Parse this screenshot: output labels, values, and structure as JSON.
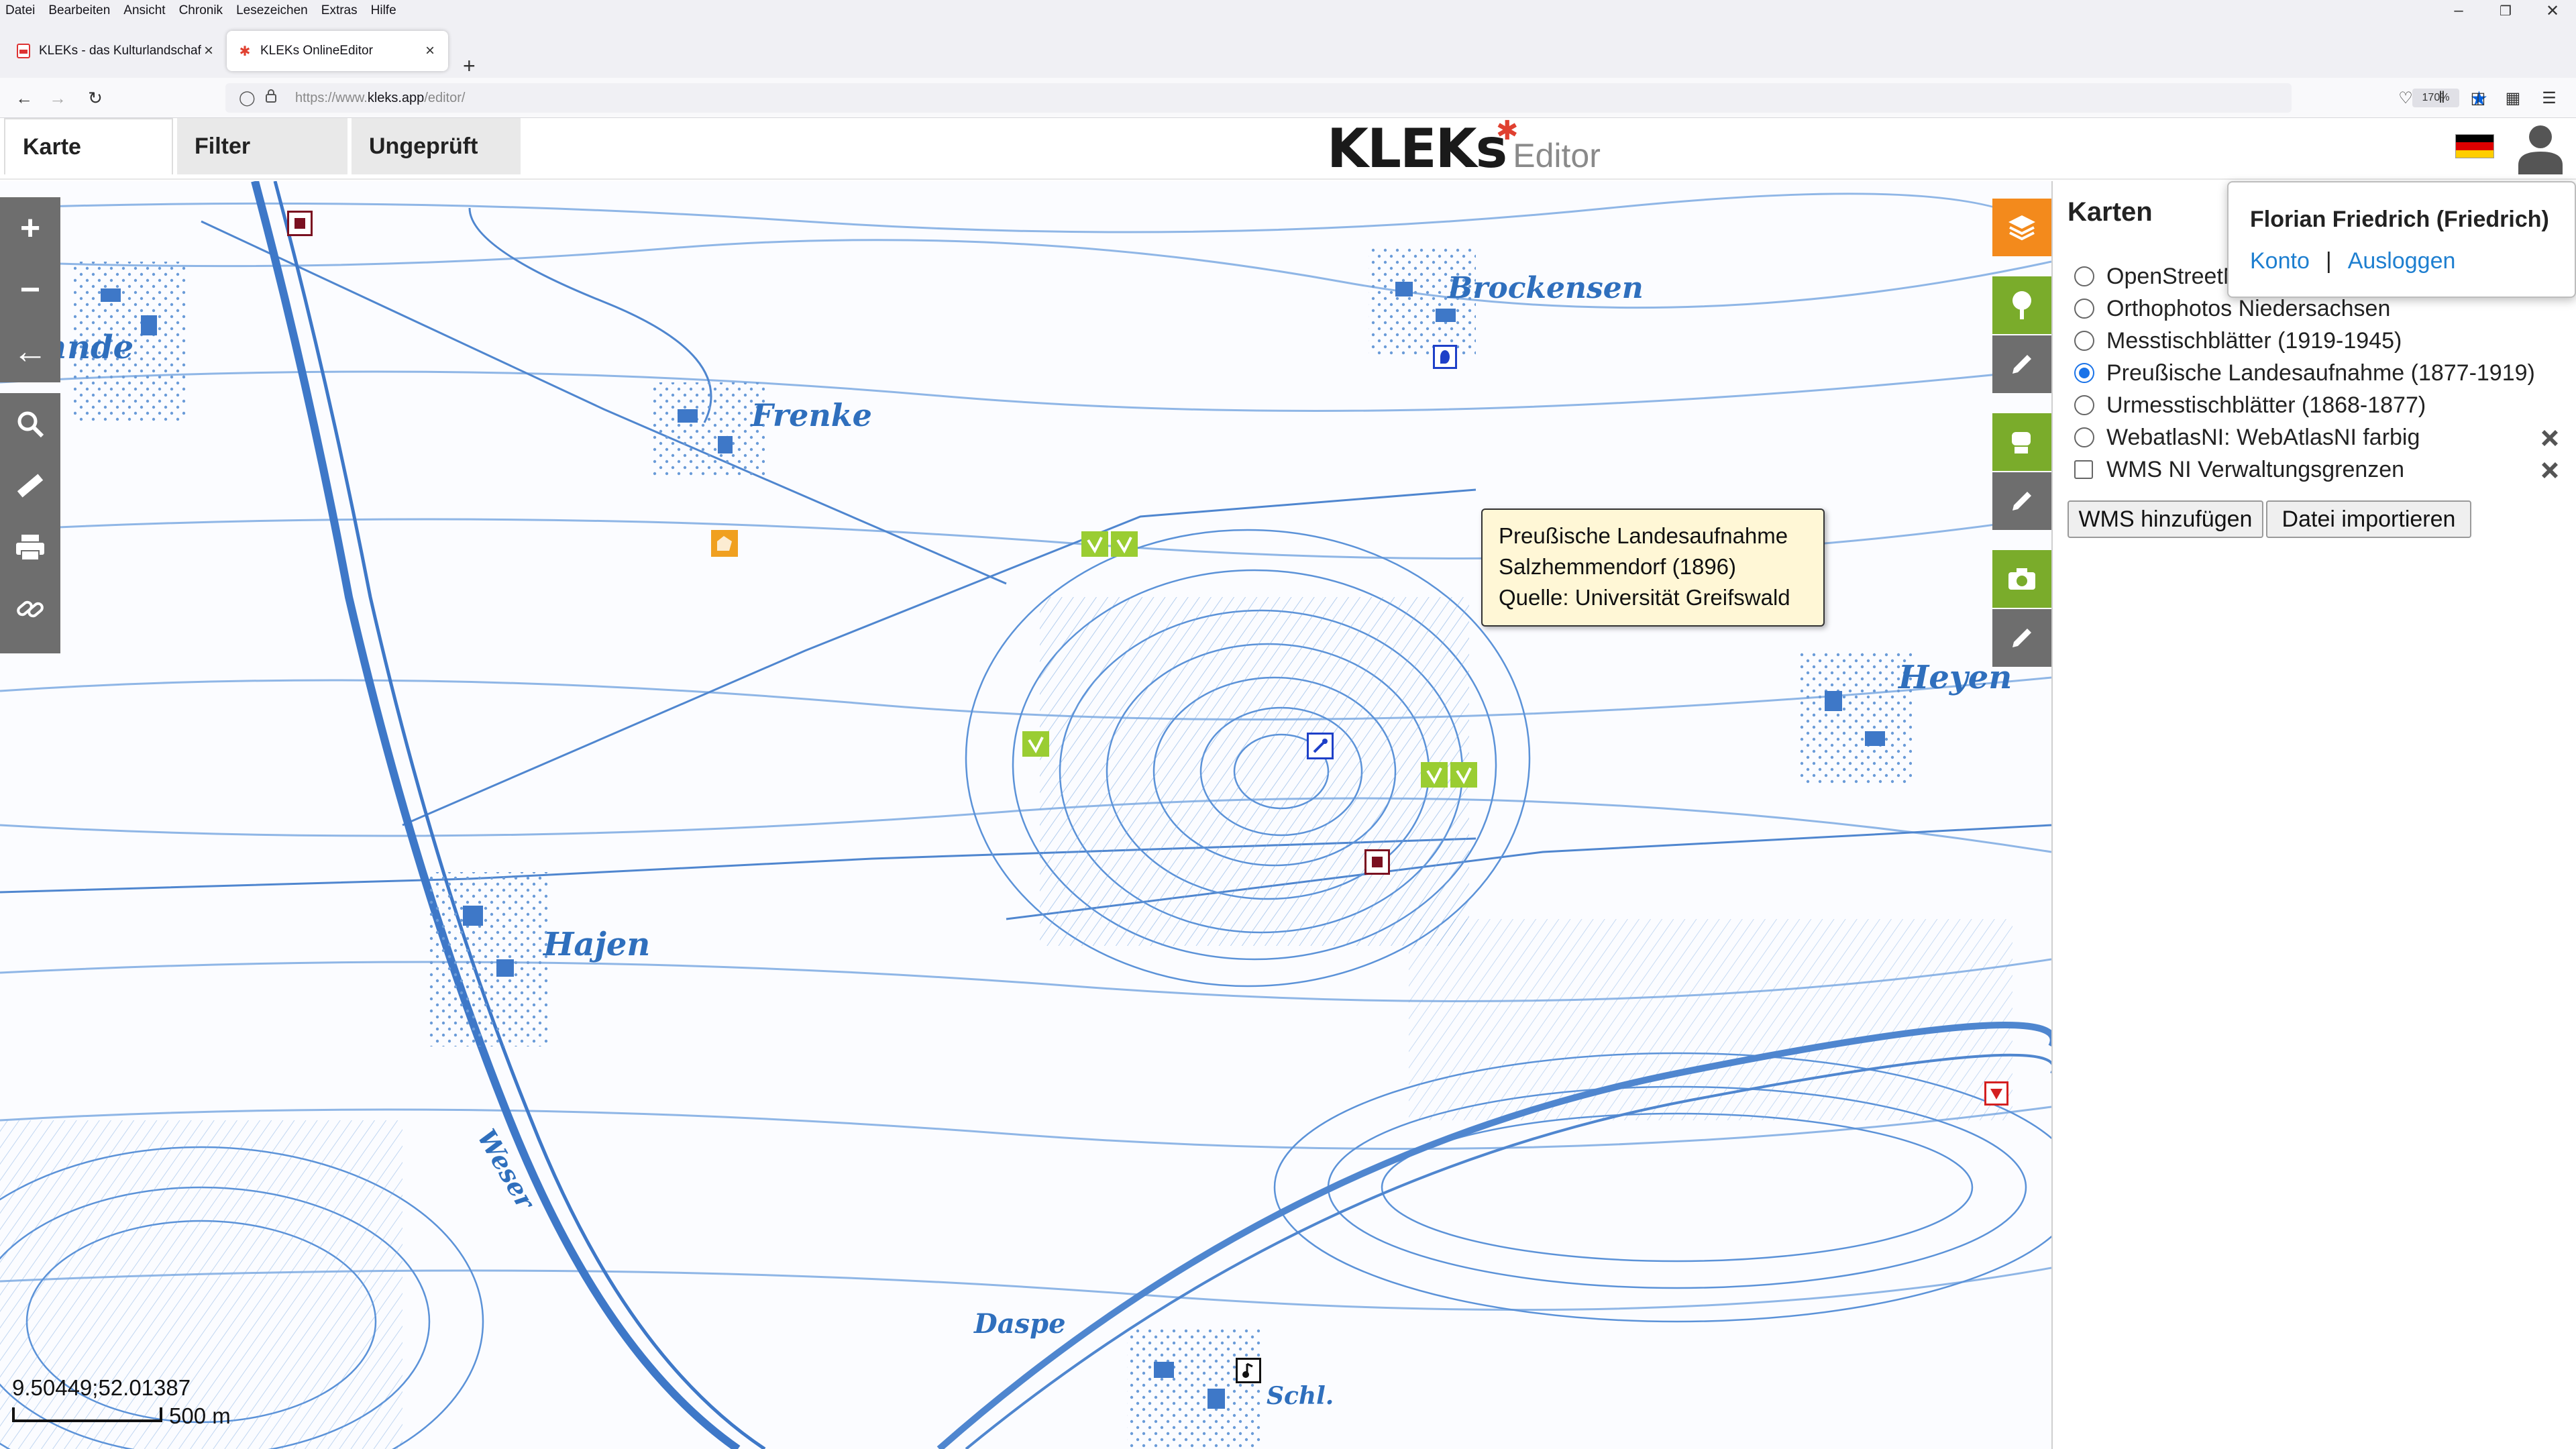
{
  "browser": {
    "menu": [
      "Datei",
      "Bearbeiten",
      "Ansicht",
      "Chronik",
      "Lesezeichen",
      "Extras",
      "Hilfe"
    ],
    "tabs": [
      {
        "title": "KLEKs - das Kulturlandschafts-W",
        "active": false
      },
      {
        "title": "KLEKs OnlineEditor",
        "active": true
      }
    ],
    "url_host": "https://www.",
    "url_domain": "kleks.app",
    "url_path": "/editor/",
    "zoom": "170%"
  },
  "header": {
    "tabs": [
      "Karte",
      "Filter",
      "Ungeprüft"
    ],
    "active_tab": "Karte",
    "logo_text": "KLEKs",
    "logo_suffix": "Editor",
    "language": "de"
  },
  "map": {
    "places": [
      "Sehnde",
      "Frenke",
      "Brockensen",
      "Heyen",
      "Hajen",
      "Daspe",
      "Schl.",
      "Weser"
    ],
    "tooltip": {
      "line1": "Preußische Landesaufnahme",
      "line2": "Salzhemmendorf (1896)",
      "line3": "Quelle: Universität Greifswald"
    },
    "coordinates": "9.50449;52.01387",
    "scale_label": "500 m",
    "controls": [
      "zoom-in",
      "zoom-out",
      "back",
      "search",
      "measure",
      "print",
      "link"
    ],
    "colors": {
      "map_lines": "#2f6fbd",
      "tool_orange": "#f38a1c",
      "tool_green": "#7aac2b",
      "marker_green": "#9acd32",
      "marker_orange": "#f0a020",
      "marker_darkred": "#7a1020",
      "marker_blue": "#1e40c8",
      "marker_red": "#d42020"
    }
  },
  "panel": {
    "title": "Karten",
    "layers": [
      {
        "label": "OpenStreetMap",
        "type": "radio",
        "checked": false,
        "removable": false
      },
      {
        "label": "Orthophotos Niedersachsen",
        "type": "radio",
        "checked": false,
        "removable": false
      },
      {
        "label": "Messtischblätter (1919-1945)",
        "type": "radio",
        "checked": false,
        "removable": false
      },
      {
        "label": "Preußische Landesaufnahme (1877-1919)",
        "type": "radio",
        "checked": true,
        "removable": false
      },
      {
        "label": "Urmesstischblätter (1868-1877)",
        "type": "radio",
        "checked": false,
        "removable": false
      },
      {
        "label": "WebatlasNI: WebAtlasNI farbig",
        "type": "radio",
        "checked": false,
        "removable": true
      },
      {
        "label": "WMS NI Verwaltungsgrenzen",
        "type": "checkbox",
        "checked": false,
        "removable": true
      }
    ],
    "buttons": {
      "add_wms": "WMS hinzufügen",
      "import_file": "Datei importieren"
    }
  },
  "user": {
    "name": "Florian Friedrich (Friedrich)",
    "account": "Konto",
    "separator": "|",
    "logout": "Ausloggen"
  }
}
